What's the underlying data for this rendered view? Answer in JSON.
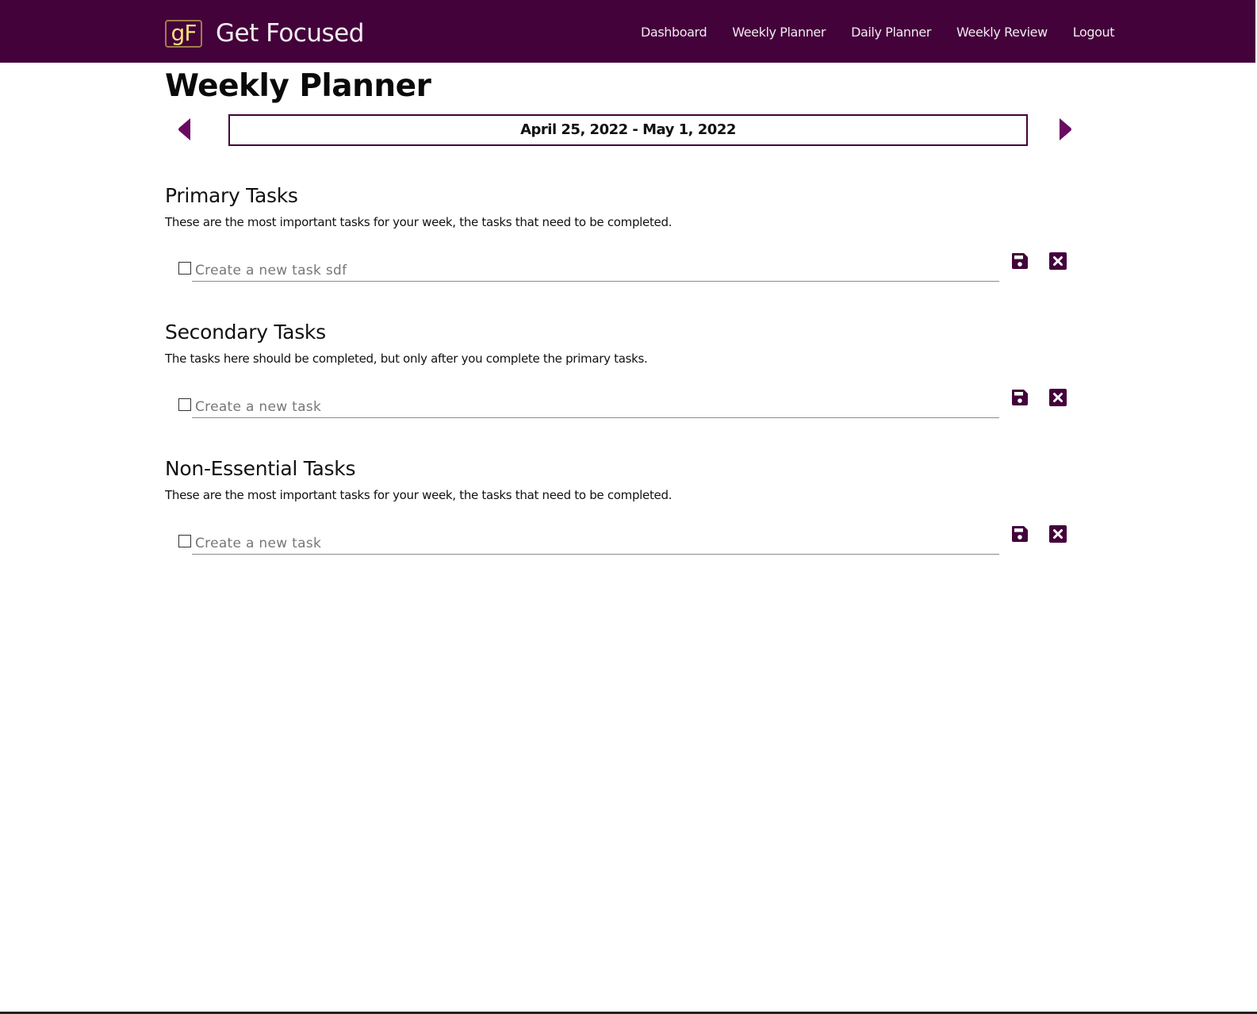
{
  "brand": {
    "logo_text": "gF",
    "name": "Get Focused"
  },
  "nav": {
    "links": [
      {
        "label": "Dashboard"
      },
      {
        "label": "Weekly Planner"
      },
      {
        "label": "Daily Planner"
      },
      {
        "label": "Weekly Review"
      },
      {
        "label": "Logout"
      }
    ]
  },
  "page": {
    "title": "Weekly Planner",
    "date_range": "April 25, 2022 - May 1, 2022",
    "prev_icon": "caret-left-icon",
    "next_icon": "caret-right-icon"
  },
  "sections": [
    {
      "title": "Primary Tasks",
      "description": "These are the most important tasks for your week, the tasks that need to be completed.",
      "task_placeholder": "Create a new task sdf",
      "task_value": "",
      "checked": false
    },
    {
      "title": "Secondary Tasks",
      "description": "The tasks here should be completed, but only after you complete the primary tasks.",
      "task_placeholder": "Create a new task",
      "task_value": "",
      "checked": false
    },
    {
      "title": "Non-Essential Tasks",
      "description": "These are the most important tasks for your week, the tasks that need to be completed.",
      "task_placeholder": "Create a new task",
      "task_value": "",
      "checked": false
    }
  ],
  "icons": {
    "save": "floppy-disk-icon",
    "cancel": "close-square-icon"
  },
  "colors": {
    "brand": "#43023a",
    "accent": "#6a0a60",
    "logo_text": "#f3e27a"
  }
}
